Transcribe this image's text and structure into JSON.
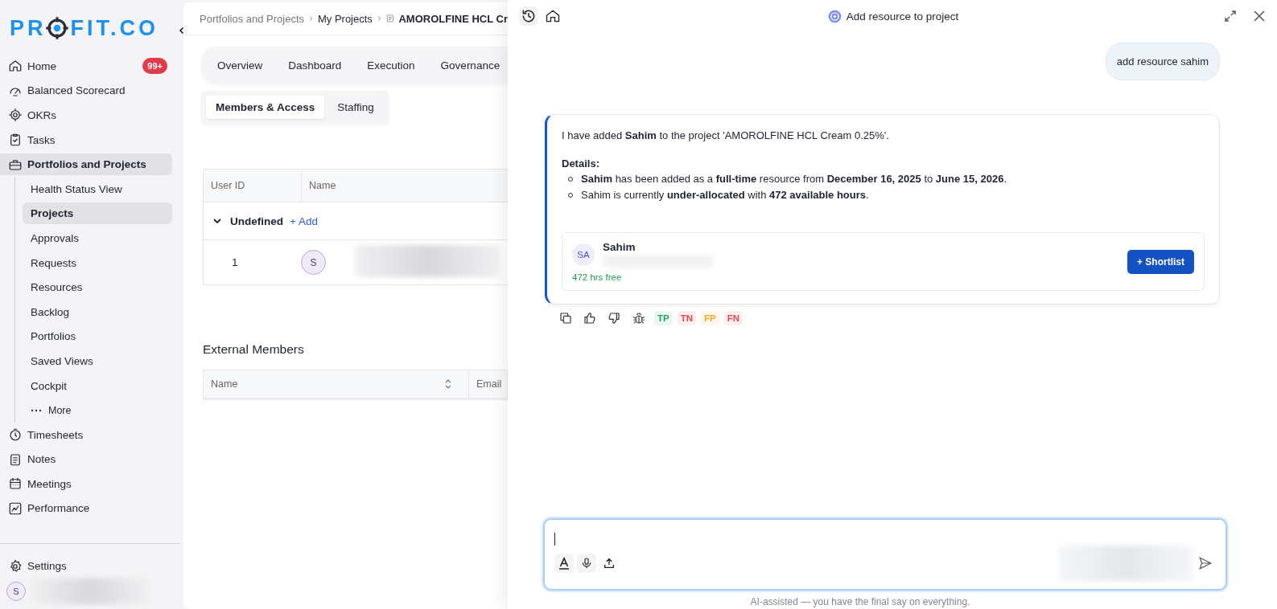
{
  "sidebar": {
    "logo": {
      "before": "PR",
      "after": "FIT.CO"
    },
    "items": [
      {
        "label": "Home",
        "badge": "99+",
        "selected": false
      },
      {
        "label": "Balanced Scorecard",
        "selected": false
      },
      {
        "label": "OKRs",
        "selected": false
      },
      {
        "label": "Tasks",
        "selected": false
      },
      {
        "label": "Portfolios and Projects",
        "selected": true,
        "expanded": true,
        "children": [
          {
            "label": "Health Status View",
            "selected": false,
            "kind": "link"
          },
          {
            "label": "Projects",
            "selected": true,
            "kind": "link"
          },
          {
            "label": "Approvals",
            "selected": false,
            "kind": "link"
          },
          {
            "label": "Requests",
            "selected": false,
            "kind": "link"
          },
          {
            "label": "Resources",
            "selected": false,
            "kind": "link"
          },
          {
            "label": "Backlog",
            "selected": false,
            "kind": "link"
          },
          {
            "label": "Portfolios",
            "selected": false,
            "kind": "link"
          },
          {
            "label": "Saved Views",
            "selected": false,
            "kind": "link"
          },
          {
            "label": "Cockpit",
            "selected": false,
            "kind": "link"
          },
          {
            "label": "More",
            "selected": false,
            "kind": "more"
          }
        ]
      },
      {
        "label": "Timesheets",
        "selected": false
      },
      {
        "label": "Notes",
        "selected": false
      },
      {
        "label": "Meetings",
        "selected": false
      },
      {
        "label": "Performance",
        "selected": false
      }
    ],
    "settings": "Settings",
    "user_initial": "S"
  },
  "main": {
    "breadcrumb": [
      "Portfolios and Projects",
      "My Projects",
      "AMOROLFINE HCL Cr"
    ],
    "tabs": [
      {
        "label": "Overview",
        "selected": false
      },
      {
        "label": "Dashboard",
        "selected": false
      },
      {
        "label": "Execution",
        "selected": false
      },
      {
        "label": "Governance",
        "selected": false
      }
    ],
    "subtabs": [
      {
        "label": "Members & Access",
        "selected": true
      },
      {
        "label": "Staffing",
        "selected": false
      }
    ],
    "members_table": {
      "columns": [
        "User ID",
        "Name"
      ],
      "group": {
        "label": "Undefined",
        "expanded": true,
        "add": "+ Add"
      },
      "rows": [
        {
          "user_id": "1",
          "initial": "S"
        }
      ]
    },
    "external_members": {
      "title": "External Members",
      "columns": [
        "Name",
        "Email"
      ]
    }
  },
  "chat": {
    "title": "Add resource to project",
    "user_message": "add resource sahim",
    "reply": {
      "intro": "I have added **Sahim** to the project 'AMOROLFINE HCL Cream 0.25%'.",
      "details_label": "Details:",
      "bullets": [
        "**Sahim** has been added as a **full-time** resource from **December 16, 2025** to **June 15, 2026**.",
        "Sahim is currently **under-allocated** with **472 available hours**."
      ],
      "resource": {
        "initials": "SA",
        "name": "Sahim",
        "availability": "472 hrs free",
        "action": "+ Shortlist"
      }
    },
    "feedback_tags": [
      {
        "label": "TP",
        "color": "#22a45d"
      },
      {
        "label": "TN",
        "color": "#e5484d"
      },
      {
        "label": "FP",
        "color": "#f5a623"
      },
      {
        "label": "FN",
        "color": "#e5484d"
      }
    ],
    "disclaimer": "AI-assisted — you have the final say on everything."
  }
}
